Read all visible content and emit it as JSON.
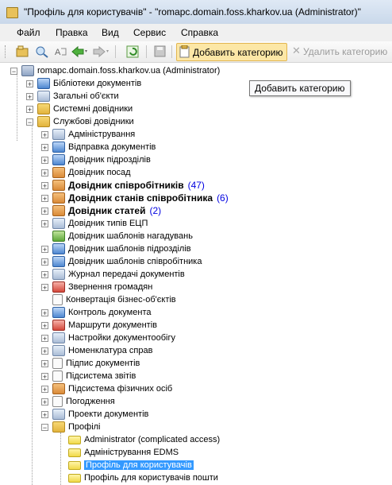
{
  "window": {
    "title": "\"Профіль для користувачів\" - \"romapc.domain.foss.kharkov.ua (Administrator)\""
  },
  "menu": [
    "Файл",
    "Правка",
    "Вид",
    "Сервис",
    "Справка"
  ],
  "toolbar": {
    "add_category": "Добавить категорию",
    "delete_category": "Удалить категорию"
  },
  "tooltip": "Добавить категорию",
  "tree": {
    "root": "romapc.domain.foss.kharkov.ua (Administrator)",
    "top": [
      "Бібліотеки документів",
      "Загальні об'єкти",
      "Системні довідники",
      "Службові довідники"
    ],
    "service": [
      {
        "label": "Адміністрування"
      },
      {
        "label": "Відправка документів"
      },
      {
        "label": "Довідник підрозділів"
      },
      {
        "label": "Довідник посад"
      },
      {
        "label": "Довідник співробітників",
        "bold": true,
        "count": "(47)"
      },
      {
        "label": "Довідник станів співробітника",
        "bold": true,
        "count": "(6)"
      },
      {
        "label": "Довідник статей",
        "bold": true,
        "count": "(2)"
      },
      {
        "label": "Довідник типів ЕЦП"
      },
      {
        "label": "Довідник шаблонів нагадувань"
      },
      {
        "label": "Довідник шаблонів підрозділів"
      },
      {
        "label": "Довідник шаблонів співробітника"
      },
      {
        "label": "Журнал передачі документів"
      },
      {
        "label": "Звернення громадян"
      },
      {
        "label": "Конвертація бізнес-об'єктів"
      },
      {
        "label": "Контроль документа"
      },
      {
        "label": "Маршрути документів"
      },
      {
        "label": "Настройки документообігу"
      },
      {
        "label": "Номенклатура справ"
      },
      {
        "label": "Підпис документів"
      },
      {
        "label": "Підсистема звітів"
      },
      {
        "label": "Підсистема фізичних осіб"
      },
      {
        "label": "Погодження"
      },
      {
        "label": "Проекти документів"
      },
      {
        "label": "Профілі"
      }
    ],
    "profiles": [
      "Administrator (complicated access)",
      "Адміністрування EDMS",
      "Профіль для користувачів",
      "Профіль для користувачів пошти"
    ]
  }
}
